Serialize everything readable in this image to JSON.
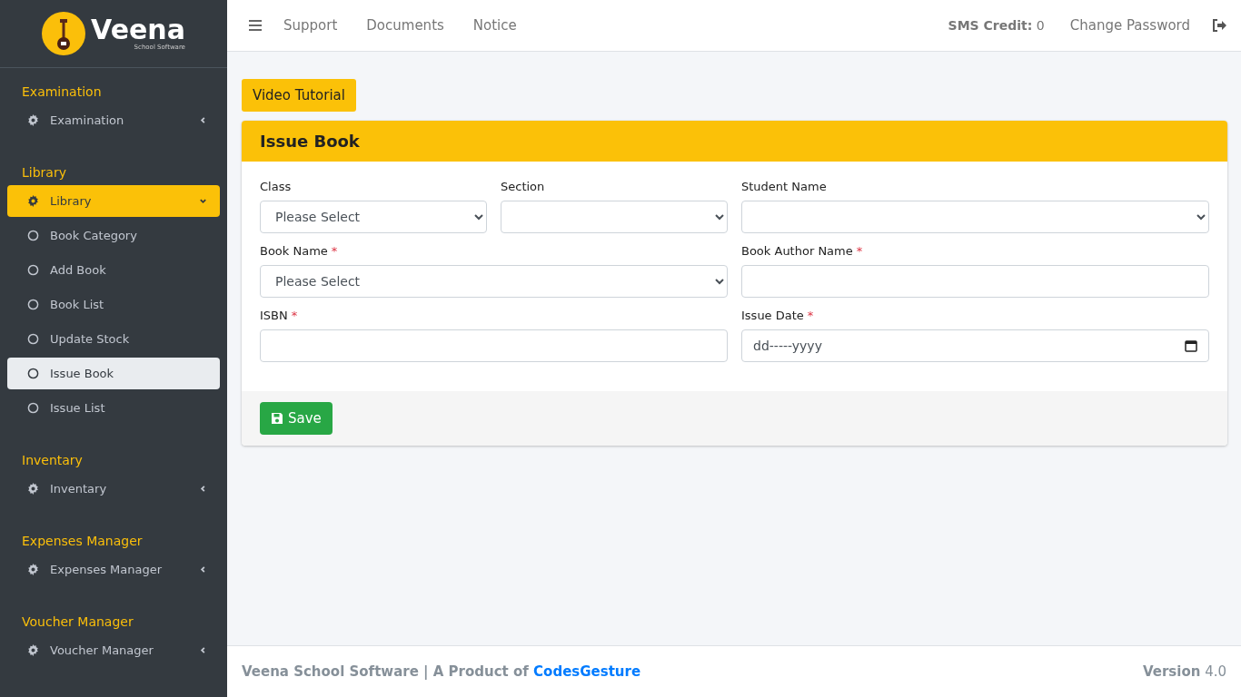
{
  "sidebar": {
    "logo": {
      "name": "Veena",
      "tagline": "School Software"
    },
    "sections": [
      {
        "heading": "Examination",
        "item": {
          "label": "Examination",
          "expanded": false
        }
      },
      {
        "heading": "Library",
        "item": {
          "label": "Library",
          "expanded": true,
          "children": [
            {
              "label": "Book Category",
              "selected": false
            },
            {
              "label": "Add Book",
              "selected": false
            },
            {
              "label": "Book List",
              "selected": false
            },
            {
              "label": "Update Stock",
              "selected": false
            },
            {
              "label": "Issue Book",
              "selected": true
            },
            {
              "label": "Issue List",
              "selected": false
            }
          ]
        }
      },
      {
        "heading": "Inventary",
        "item": {
          "label": "Inventary",
          "expanded": false
        }
      },
      {
        "heading": "Expenses Manager",
        "item": {
          "label": "Expenses Manager",
          "expanded": false
        }
      },
      {
        "heading": "Voucher Manager",
        "item": {
          "label": "Voucher Manager",
          "expanded": false
        }
      }
    ]
  },
  "header": {
    "links": [
      "Support",
      "Documents",
      "Notice"
    ],
    "sms_credit": {
      "label": "SMS Credit:",
      "value": "0"
    },
    "change_password": "Change Password"
  },
  "video_tutorial": "Video Tutorial",
  "card": {
    "title": "Issue Book",
    "rows": [
      [
        {
          "label": "Class",
          "kind": "select",
          "value": "Please Select"
        },
        {
          "label": "Section",
          "kind": "select"
        },
        {
          "label": "Student Name",
          "kind": "select"
        }
      ],
      [
        {
          "label": "Book Name",
          "required_mark": "*",
          "kind": "select",
          "value": "Please Select"
        },
        {
          "label": "Book Author Name",
          "required_mark": "*",
          "kind": "text"
        }
      ],
      [
        {
          "label": "ISBN",
          "required_mark": "*",
          "kind": "text"
        },
        {
          "label": "Issue Date",
          "required_mark": "*",
          "kind": "date",
          "value": "dd-----yyyy"
        }
      ]
    ],
    "save": "Save"
  },
  "footer": {
    "text": "Veena School Software | A Product of",
    "link": "CodesGesture",
    "version_label": "Version",
    "version": "4.0"
  }
}
